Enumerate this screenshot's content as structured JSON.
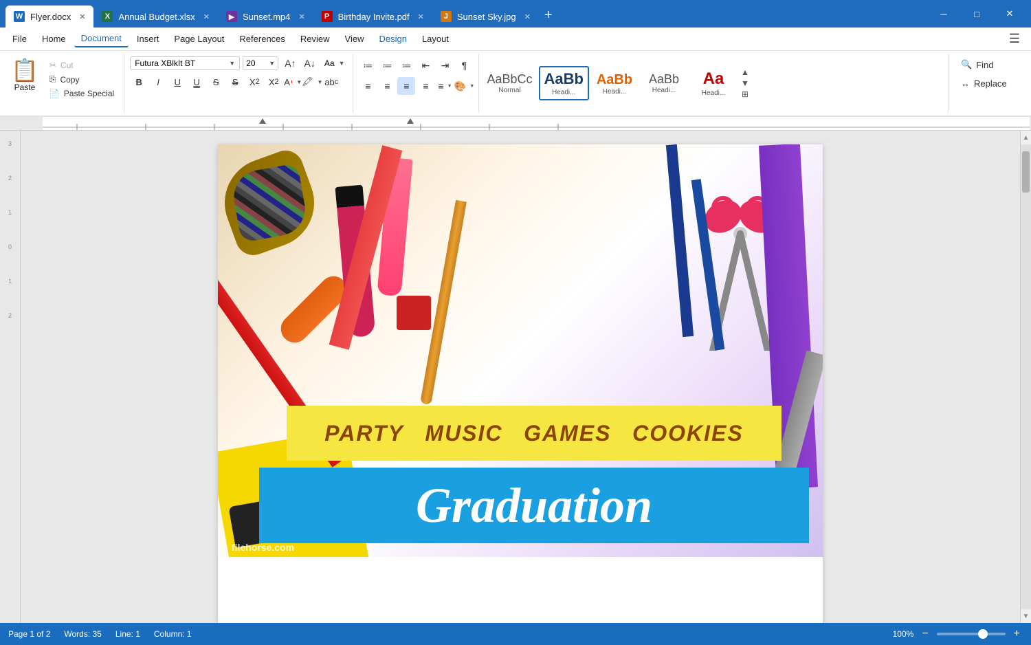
{
  "titlebar": {
    "tabs": [
      {
        "id": "flyer",
        "icon_color": "#1a6cbf",
        "icon_char": "W",
        "label": "Flyer.docx",
        "active": true
      },
      {
        "id": "budget",
        "icon_color": "#217346",
        "icon_char": "X",
        "label": "Annual Budget.xlsx",
        "active": false
      },
      {
        "id": "sunset_mp4",
        "icon_color": "#7030a0",
        "icon_char": "▶",
        "label": "Sunset.mp4",
        "active": false
      },
      {
        "id": "birthday",
        "icon_color": "#c00000",
        "icon_char": "P",
        "label": "Birthday Invite.pdf",
        "active": false
      },
      {
        "id": "sunset_jpg",
        "icon_color": "#d4770e",
        "icon_char": "J",
        "label": "Sunset Sky.jpg",
        "active": false
      }
    ],
    "new_tab_label": "+",
    "minimize": "—",
    "maximize": "□",
    "close": "✕"
  },
  "menubar": {
    "items": [
      {
        "label": "File",
        "active": false
      },
      {
        "label": "Home",
        "active": false
      },
      {
        "label": "Document",
        "active": true,
        "underline": true
      },
      {
        "label": "Insert",
        "active": false
      },
      {
        "label": "Page Layout",
        "active": false
      },
      {
        "label": "References",
        "active": false
      },
      {
        "label": "Review",
        "active": false
      },
      {
        "label": "View",
        "active": false
      },
      {
        "label": "Design",
        "active": false,
        "colored": true
      },
      {
        "label": "Layout",
        "active": false
      }
    ]
  },
  "ribbon": {
    "paste_section": {
      "label": "",
      "paste_label": "Paste",
      "cut_label": "Cut",
      "copy_label": "Copy",
      "paste_special_label": "Paste Special"
    },
    "font_section": {
      "font_name": "Futura XBlkIt BT",
      "font_size": "20",
      "format_buttons": [
        "B",
        "I",
        "U",
        "U",
        "S",
        "S",
        "X²",
        "X₂"
      ],
      "aa_label": "Aa"
    },
    "list_section": {
      "alignment_btns": [
        "≡",
        "≡",
        "≡",
        "≡",
        "≡",
        "¶"
      ],
      "list_btns": [
        "☰",
        "☰",
        "☰"
      ]
    },
    "styles": [
      {
        "label": "Normal",
        "preview": "AaBbCc"
      },
      {
        "label": "Headi...",
        "preview": "AaBb",
        "selected": true
      },
      {
        "label": "Headi...",
        "preview": "AaBb"
      },
      {
        "label": "Headi...",
        "preview": "AaBb"
      },
      {
        "label": "Headi...",
        "preview": "Aa",
        "colored": true
      }
    ],
    "find_replace": {
      "find_label": "Find",
      "replace_label": "Replace"
    }
  },
  "document": {
    "party_words": [
      "PARTY",
      "MUSIC",
      "GAMES",
      "COOKIES"
    ],
    "graduation_text": "Graduation",
    "watermark": "filehorse.com"
  },
  "statusbar": {
    "page_info": "Page 1 of 2",
    "words": "Words: 35",
    "line": "Line: 1",
    "column": "Column: 1",
    "zoom_level": "100%",
    "zoom_minus": "−",
    "zoom_plus": "+"
  }
}
